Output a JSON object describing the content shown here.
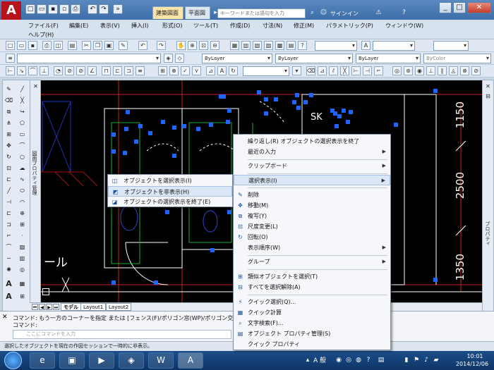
{
  "colors": {
    "canvas_bg": "#000000",
    "grip": "#1e64ff",
    "wall": "#ffffff",
    "accent_red": "#cc2222",
    "title_bar": "#3d6ea8"
  },
  "title_bar": {
    "app_logo": "A",
    "doc_tab_1": "建築図面 B",
    "doc_tab_2": "平面図",
    "search_placeholder": "キーワードまたは語句を入力",
    "signin": "サインイン",
    "help_icon": "?"
  },
  "menubar": {
    "items": [
      "ファイル(F)",
      "編集(E)",
      "表示(V)",
      "挿入(I)",
      "形式(O)",
      "ツール(T)",
      "作成(D)",
      "寸法(N)",
      "修正(M)",
      "パラメトリック(P)",
      "ウィンドウ(W)"
    ],
    "help": "ヘルプ(H)"
  },
  "toolbar_props": {
    "layer_combo": "ByLayer",
    "color_combo": "ByLayer",
    "linetype_combo": "ByLayer",
    "lineweight_combo": "ByColor"
  },
  "left_palette_label": "図面プロパティ管理",
  "right_palette_label": "プロパティ",
  "canvas": {
    "dim_top": "1150",
    "dim_mid": "2500",
    "dim_bottom": "1350",
    "room_label": "SK",
    "partial_text": "ール"
  },
  "layout_tabs": [
    "モデル",
    "Layout1",
    "Layout2"
  ],
  "command": {
    "history_1": "コマンド: もう一方のコーナーを指定 または [フェンス(F)/ポリゴン窓(WP)/ポリゴン交差",
    "history_2": "コマンド:",
    "input_placeholder": "ここにコマンドを入力"
  },
  "status_bar": "選択したオブジェクトを現在の作図セッションで一時的に非表示。",
  "isolate_submenu": {
    "items": [
      {
        "label": "オブジェクトを選択表示(I)",
        "icon": "isolate-icon"
      },
      {
        "label": "オブジェクトを非表示(H)",
        "icon": "hide-icon"
      },
      {
        "label": "オブジェクトの選択表示を終了(E)",
        "icon": "end-isolate-icon"
      }
    ]
  },
  "context_menu": {
    "repeat": "繰り返し(R) オブジェクトの選択表示を終了",
    "recent_input": "最近の入力",
    "clipboard": "クリップボード",
    "isolate": "選択表示(I)",
    "erase": "削除",
    "move": "移動(M)",
    "copy": "複写(Y)",
    "scale": "尺度変更(L)",
    "rotate": "回転(O)",
    "draw_order": "表示順序(W)",
    "group": "グループ",
    "select_similar": "類似オブジェクトを選択(T)",
    "deselect_all": "すべてを選択解除(A)",
    "quick_select": "クイック選択(Q)...",
    "quick_calc": "クイック計算",
    "find": "文字検索(F)...",
    "properties": "オブジェクト プロパティ管理(S)",
    "quick_properties": "クイック プロパティ"
  },
  "taskbar": {
    "ime": "A 般",
    "time": "10:01",
    "date": "2014/12/06"
  }
}
